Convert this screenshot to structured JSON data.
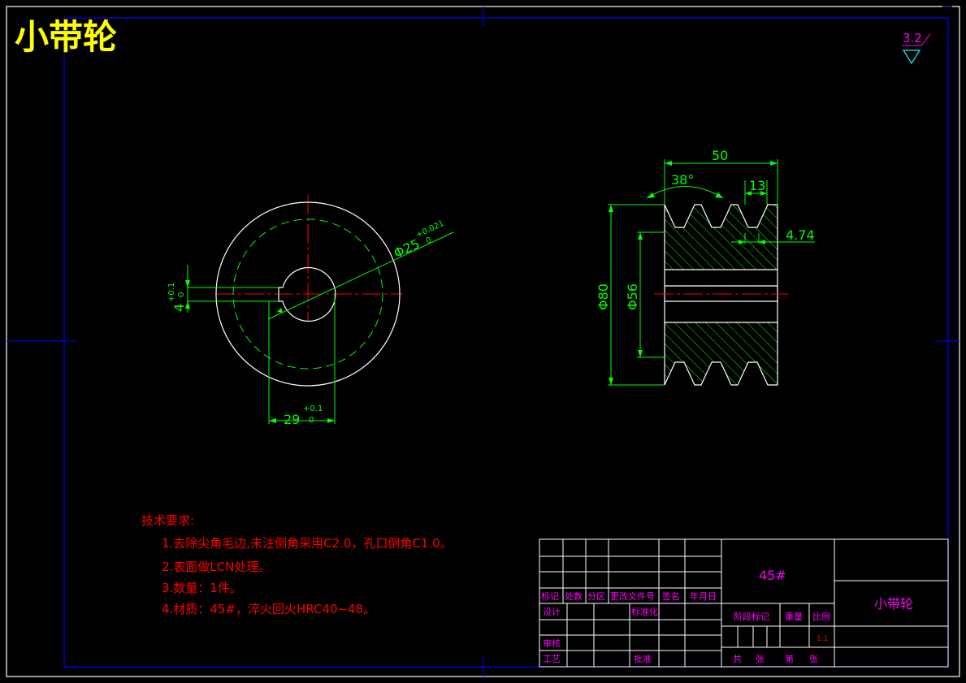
{
  "title": "小带轮",
  "roughness": "3.2",
  "dims": {
    "bore_dia": "Φ25",
    "bore_tol_upper": "+0.021",
    "bore_tol_lower": "0",
    "key_depth": "4",
    "key_tol_upper": "+0.1",
    "key_tol_lower": "0",
    "hub_width": "29",
    "hub_tol_upper": "+0.1",
    "hub_tol_lower": "0",
    "width": "50",
    "groove_angle": "38°",
    "groove_pitch": "13",
    "groove_depth": "4.74",
    "outer_dia": "Φ80",
    "inner_dia": "Φ56"
  },
  "notes": {
    "heading": "技术要求:",
    "items": [
      "1.去除尖角毛边,未注倒角采用C2.0，孔口倒角C1.0。",
      "2.表面做LCN处理。",
      "3.数量：1件。",
      "4.材质：45#，淬火回火HRC40~48。"
    ]
  },
  "titleblock": {
    "material": "45#",
    "part_name": "小带轮",
    "row_labels": [
      "标记",
      "处数",
      "分区",
      "更改文件号",
      "签名",
      "年月日"
    ],
    "design": "设计",
    "standard": "标准化",
    "check": "审核",
    "process": "工艺",
    "approve": "批准",
    "stage": "阶段标记",
    "weight": "重量",
    "scale_label": "比例",
    "scale": "1:1",
    "total": "共",
    "sheets1": "张",
    "sheet_no": "第",
    "sheets2": "张"
  },
  "colors": {
    "outline": "#ffffff",
    "dimension": "#00ff00",
    "center": "#ff0000",
    "frame": "#0000ff",
    "title": "#ffff00",
    "notes": "#ff0000",
    "label": "#ff00ff"
  }
}
